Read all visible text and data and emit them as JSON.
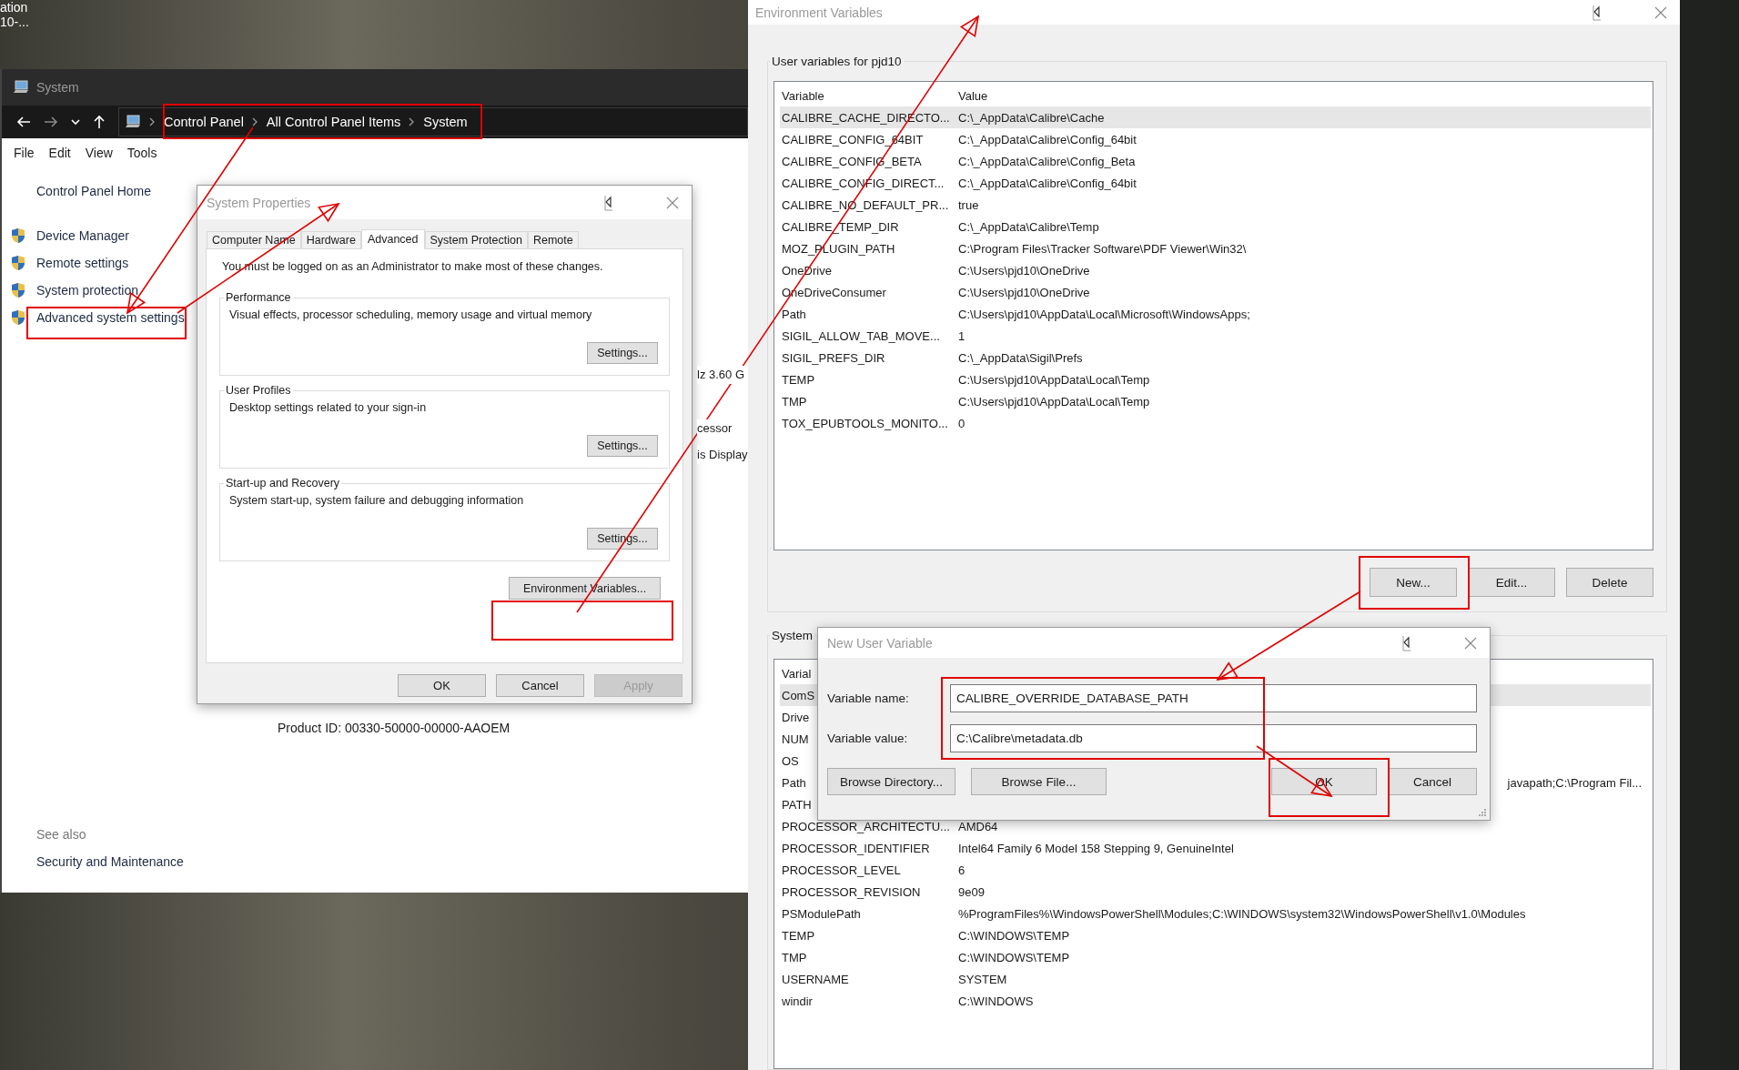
{
  "desktop": {
    "icon_label_lines": [
      "ation",
      "10-..."
    ]
  },
  "system_window": {
    "title": "System",
    "breadcrumb": [
      "Control Panel",
      "All Control Panel Items",
      "System"
    ],
    "menu": [
      "File",
      "Edit",
      "View",
      "Tools"
    ],
    "home_link": "Control Panel Home",
    "tasks": [
      "Device Manager",
      "Remote settings",
      "System protection",
      "Advanced system settings"
    ],
    "partial_texts": [
      "lz  3.60 G",
      "cessor",
      "is Display"
    ],
    "product_id": "Product ID:  00330-50000-00000-AAOEM",
    "see_also": {
      "heading": "See also",
      "links": [
        "Security and Maintenance"
      ]
    }
  },
  "system_properties": {
    "title": "System Properties",
    "tabs": [
      {
        "label": "Computer Name",
        "selected": false
      },
      {
        "label": "Hardware",
        "selected": false
      },
      {
        "label": "Advanced",
        "selected": true
      },
      {
        "label": "System Protection",
        "selected": false
      },
      {
        "label": "Remote",
        "selected": false
      }
    ],
    "note": "You must be logged on as an Administrator to make most of these changes.",
    "groups": [
      {
        "title": "Performance",
        "description": "Visual effects, processor scheduling, memory usage and virtual memory",
        "button": "Settings..."
      },
      {
        "title": "User Profiles",
        "description": "Desktop settings related to your sign-in",
        "button": "Settings..."
      },
      {
        "title": "Start-up and Recovery",
        "description": "System start-up, system failure and debugging information",
        "button": "Settings..."
      }
    ],
    "env_button": "Environment Variables...",
    "buttons": [
      {
        "label": "OK",
        "disabled": false
      },
      {
        "label": "Cancel",
        "disabled": false
      },
      {
        "label": "Apply",
        "disabled": true
      }
    ]
  },
  "environment_variables": {
    "title": "Environment Variables",
    "user_group": "User variables for pjd10",
    "user_columns": [
      "Variable",
      "Value"
    ],
    "user_rows": [
      {
        "variable": "CALIBRE_CACHE_DIRECTO...",
        "value": "C:\\_AppData\\Calibre\\Cache",
        "selected": true
      },
      {
        "variable": "CALIBRE_CONFIG_64BIT",
        "value": "C:\\_AppData\\Calibre\\Config_64bit",
        "selected": false
      },
      {
        "variable": "CALIBRE_CONFIG_BETA",
        "value": "C:\\_AppData\\Calibre\\Config_Beta",
        "selected": false
      },
      {
        "variable": "CALIBRE_CONFIG_DIRECT...",
        "value": "C:\\_AppData\\Calibre\\Config_64bit",
        "selected": false
      },
      {
        "variable": "CALIBRE_NO_DEFAULT_PR...",
        "value": "true",
        "selected": false
      },
      {
        "variable": "CALIBRE_TEMP_DIR",
        "value": "C:\\_AppData\\Calibre\\Temp",
        "selected": false
      },
      {
        "variable": "MOZ_PLUGIN_PATH",
        "value": "C:\\Program Files\\Tracker Software\\PDF Viewer\\Win32\\",
        "selected": false
      },
      {
        "variable": "OneDrive",
        "value": "C:\\Users\\pjd10\\OneDrive",
        "selected": false
      },
      {
        "variable": "OneDriveConsumer",
        "value": "C:\\Users\\pjd10\\OneDrive",
        "selected": false
      },
      {
        "variable": "Path",
        "value": "C:\\Users\\pjd10\\AppData\\Local\\Microsoft\\WindowsApps;",
        "selected": false
      },
      {
        "variable": "SIGIL_ALLOW_TAB_MOVE...",
        "value": "1",
        "selected": false
      },
      {
        "variable": "SIGIL_PREFS_DIR",
        "value": "C:\\_AppData\\Sigil\\Prefs",
        "selected": false
      },
      {
        "variable": "TEMP",
        "value": "C:\\Users\\pjd10\\AppData\\Local\\Temp",
        "selected": false
      },
      {
        "variable": "TMP",
        "value": "C:\\Users\\pjd10\\AppData\\Local\\Temp",
        "selected": false
      },
      {
        "variable": "TOX_EPUBTOOLS_MONITO...",
        "value": "0",
        "selected": false
      }
    ],
    "user_buttons": [
      "New...",
      "Edit...",
      "Delete"
    ],
    "system_group": "System",
    "system_columns": [
      "Varial"
    ],
    "system_rows": [
      {
        "kind": "covered",
        "variable": "ComS",
        "selected": true
      },
      {
        "kind": "covered",
        "variable": "Drive",
        "selected": false
      },
      {
        "kind": "covered",
        "variable": "NUM",
        "selected": false
      },
      {
        "kind": "covered",
        "variable": "OS",
        "selected": false
      },
      {
        "kind": "covered",
        "variable": "Path",
        "value": "javapath;C:\\Program Fil...",
        "selected": false
      },
      {
        "kind": "covered",
        "variable": "PATH",
        "selected": false
      },
      {
        "kind": "full",
        "variable": "PROCESSOR_ARCHITECTU...",
        "value": "AMD64",
        "selected": false
      },
      {
        "kind": "full",
        "variable": "PROCESSOR_IDENTIFIER",
        "value": "Intel64 Family 6 Model 158 Stepping 9, GenuineIntel",
        "selected": false
      },
      {
        "kind": "full",
        "variable": "PROCESSOR_LEVEL",
        "value": "6",
        "selected": false
      },
      {
        "kind": "full",
        "variable": "PROCESSOR_REVISION",
        "value": "9e09",
        "selected": false
      },
      {
        "kind": "full",
        "variable": "PSModulePath",
        "value": "%ProgramFiles%\\WindowsPowerShell\\Modules;C:\\WINDOWS\\system32\\WindowsPowerShell\\v1.0\\Modules",
        "selected": false
      },
      {
        "kind": "full",
        "variable": "TEMP",
        "value": "C:\\WINDOWS\\TEMP",
        "selected": false
      },
      {
        "kind": "full",
        "variable": "TMP",
        "value": "C:\\WINDOWS\\TEMP",
        "selected": false
      },
      {
        "kind": "full",
        "variable": "USERNAME",
        "value": "SYSTEM",
        "selected": false
      },
      {
        "kind": "full",
        "variable": "windir",
        "value": "C:\\WINDOWS",
        "selected": false
      }
    ]
  },
  "new_variable_dialog": {
    "title": "New User Variable",
    "fields": [
      {
        "label": "Variable name:",
        "value": "CALIBRE_OVERRIDE_DATABASE_PATH"
      },
      {
        "label": "Variable value:",
        "value": "C:\\Calibre\\metadata.db"
      }
    ],
    "buttons": [
      "Browse Directory...",
      "Browse File...",
      "OK",
      "Cancel"
    ]
  }
}
